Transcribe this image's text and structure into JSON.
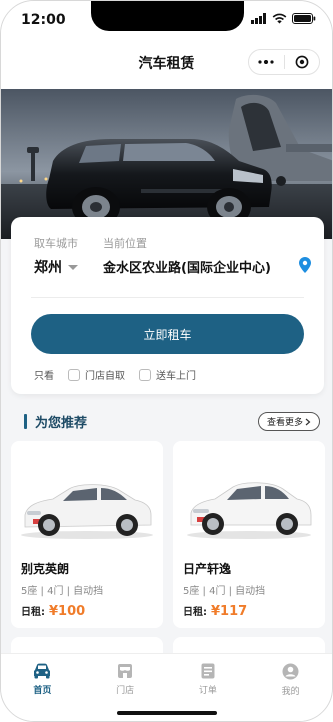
{
  "status_bar": {
    "time": "12:00"
  },
  "navbar": {
    "title": "汽车租赁"
  },
  "rent": {
    "city_label": "取车城市",
    "city": "郑州",
    "location_label": "当前位置",
    "location": "金水区农业路(国际企业中心)",
    "button_label": "立即租车",
    "options_label": "只看",
    "options": [
      "门店自取",
      "送车上门"
    ]
  },
  "recommend": {
    "title": "为您推荐",
    "more_label": "查看更多",
    "cars": [
      {
        "name": "别克英朗",
        "spec": "5座 | 4门 | 自动挡",
        "price_label": "日租:",
        "price": "¥100"
      },
      {
        "name": "日产轩逸",
        "spec": "5座 | 4门 | 自动挡",
        "price_label": "日租:",
        "price": "¥117"
      }
    ]
  },
  "tabs": [
    {
      "label": "首页",
      "icon": "car-icon"
    },
    {
      "label": "门店",
      "icon": "store-icon"
    },
    {
      "label": "订单",
      "icon": "order-icon"
    },
    {
      "label": "我的",
      "icon": "user-icon"
    }
  ],
  "colors": {
    "primary": "#1e6184",
    "price": "#f07c2a",
    "background": "#f4f5f7"
  }
}
